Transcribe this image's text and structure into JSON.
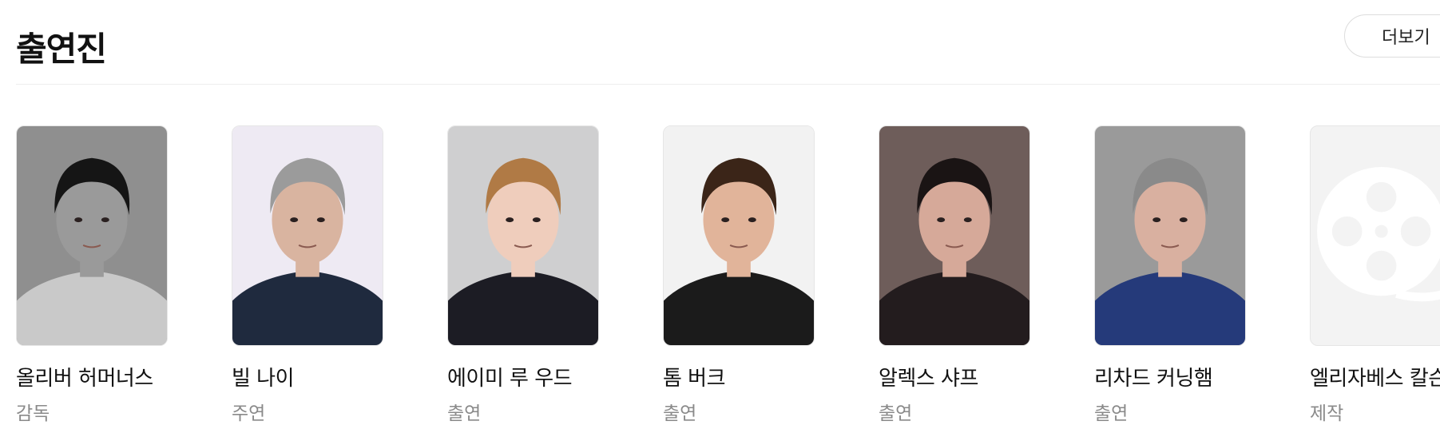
{
  "section": {
    "title": "출연진",
    "more_label": "더보기",
    "more_icon": "chevron-right-icon"
  },
  "cast": [
    {
      "name": "올리버 허머너스",
      "role": "감독",
      "bg": "#8f8f8f",
      "hair": "#151515",
      "skin": "#9a9a9a",
      "shirt": "#c9c9c9"
    },
    {
      "name": "빌 나이",
      "role": "주연",
      "bg": "#eeeaf3",
      "hair": "#9b9b9b",
      "skin": "#d9b4a0",
      "shirt": "#1f2a3e"
    },
    {
      "name": "에이미 루 우드",
      "role": "출연",
      "bg": "#cfcfd0",
      "hair": "#b07a45",
      "skin": "#efcdbc",
      "shirt": "#1c1c24"
    },
    {
      "name": "톰 버크",
      "role": "출연",
      "bg": "#f2f2f2",
      "hair": "#3b2518",
      "skin": "#e1b49a",
      "shirt": "#1b1b1b"
    },
    {
      "name": "알렉스 샤프",
      "role": "출연",
      "bg": "#6e5d5a",
      "hair": "#1a1414",
      "skin": "#d6a999",
      "shirt": "#231c1e"
    },
    {
      "name": "리차드 커닝햄",
      "role": "출연",
      "bg": "#9a9a9a",
      "hair": "#8a8a8a",
      "skin": "#d9b0a0",
      "shirt": "#253a7a"
    },
    {
      "name": "엘리자베스 칼슨",
      "role": "제작",
      "placeholder": true,
      "icon": "film-reel-icon"
    }
  ]
}
